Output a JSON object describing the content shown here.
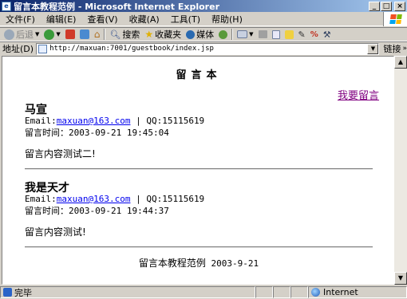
{
  "window": {
    "title": "留言本教程范例 - Microsoft Internet Explorer",
    "minimize": "_",
    "maximize": "□",
    "close": "×"
  },
  "menu": {
    "items": [
      {
        "label": "文件(F)"
      },
      {
        "label": "编辑(E)"
      },
      {
        "label": "查看(V)"
      },
      {
        "label": "收藏(A)"
      },
      {
        "label": "工具(T)"
      },
      {
        "label": "帮助(H)"
      }
    ]
  },
  "toolbar": {
    "back": "后退",
    "search": "搜索",
    "favorites": "收藏夹",
    "media": "媒体"
  },
  "address": {
    "label": "地址(D)",
    "url": "http://maxuan:7001/guestbook/index.jsp",
    "links": "链接"
  },
  "page": {
    "title": "留言本",
    "post_link": "我要留言",
    "entries": [
      {
        "author": "马宣",
        "email_prefix": "Email:",
        "email": "maxuan@163.com",
        "qq": " | QQ:15115619",
        "time": "留言时间：2003-09-21 19:45:04",
        "message": "留言内容测试二!"
      },
      {
        "author": "我是天才",
        "email_prefix": "Email:",
        "email": "maxuan@163.com",
        "qq": " | QQ:15115619",
        "time": "留言时间：2003-09-21 19:44:37",
        "message": "留言内容测试!"
      }
    ],
    "footer_text": "留言本教程范例",
    "footer_date": " 2003-9-21"
  },
  "status": {
    "text": "完毕",
    "zone": "Internet"
  },
  "colors": {
    "link": "#0000ee",
    "visited_link": "#800080",
    "titlebar": "#0a246a"
  }
}
